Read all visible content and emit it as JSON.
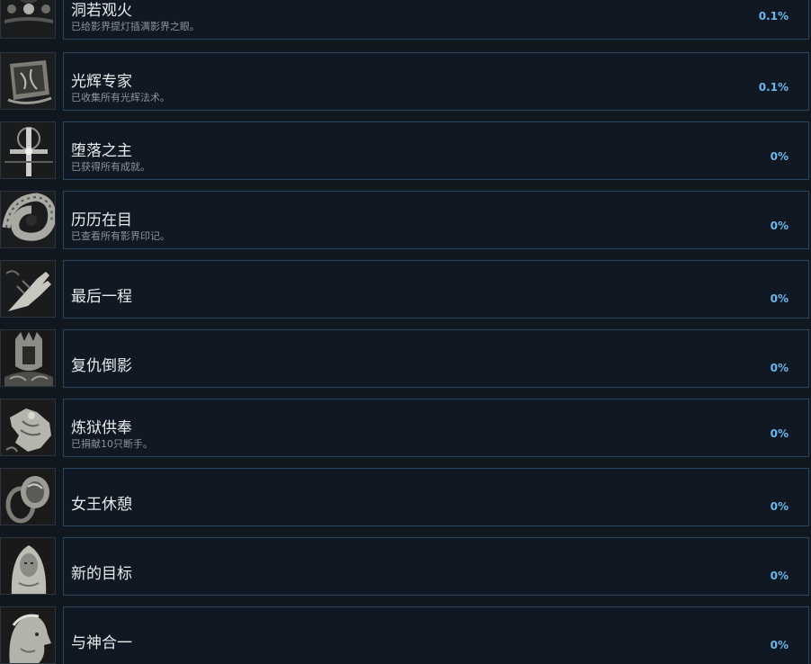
{
  "achievements": [
    {
      "title": "洞若观火",
      "desc": "已给影界提灯插满影界之眼。",
      "percent": "0.1%",
      "icon": "ornate-relic-icon"
    },
    {
      "title": "光辉专家",
      "desc": "已收集所有光辉法术。",
      "percent": "0.1%",
      "icon": "spellbook-icon"
    },
    {
      "title": "堕落之主",
      "desc": "已获得所有成就。",
      "percent": "0%",
      "icon": "sword-cross-icon"
    },
    {
      "title": "历历在目",
      "desc": "已查看所有影界印记。",
      "percent": "0%",
      "icon": "worm-creature-icon"
    },
    {
      "title": "最后一程",
      "desc": "",
      "percent": "0%",
      "icon": "outstretched-hand-icon"
    },
    {
      "title": "复仇倒影",
      "desc": "",
      "percent": "0%",
      "icon": "knight-helm-icon"
    },
    {
      "title": "炼狱供奉",
      "desc": "已捐献10只断手。",
      "percent": "0%",
      "icon": "open-palm-icon"
    },
    {
      "title": "女王休憩",
      "desc": "",
      "percent": "0%",
      "icon": "ring-icon"
    },
    {
      "title": "新的目标",
      "desc": "",
      "percent": "0%",
      "icon": "woman-portrait-icon"
    },
    {
      "title": "与神合一",
      "desc": "",
      "percent": "0%",
      "icon": "woman-profile-icon"
    }
  ]
}
